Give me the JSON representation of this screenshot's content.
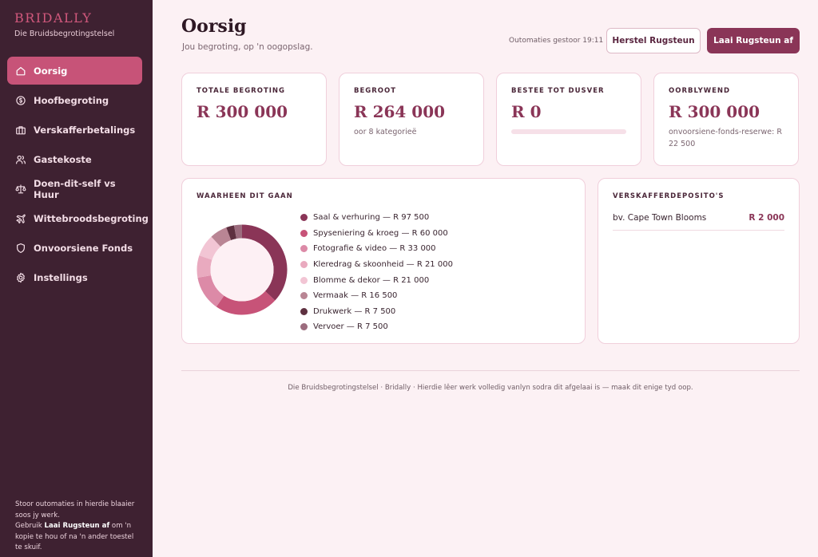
{
  "brand": {
    "name": "BRIDALLY",
    "subtitle": "Die Bruidsbegrotingstelsel"
  },
  "nav": [
    {
      "label": "Oorsig",
      "icon": "home-icon",
      "active": true
    },
    {
      "label": "Hoofbegroting",
      "icon": "coin-icon"
    },
    {
      "label": "Verskafferbetalings",
      "icon": "briefcase-icon"
    },
    {
      "label": "Gastekoste",
      "icon": "users-icon"
    },
    {
      "label": "Doen-dit-self vs Huur",
      "icon": "scale-icon"
    },
    {
      "label": "Wittebroodsbegroting",
      "icon": "plane-icon"
    },
    {
      "label": "Onvoorsiene Fonds",
      "icon": "shield-icon"
    },
    {
      "label": "Instellings",
      "icon": "gear-icon"
    }
  ],
  "sidebar_note": {
    "line1": "Stoor outomaties in hierdie blaaier soos jy werk.",
    "prefix": "Gebruik ",
    "bold": "Laai Rugsteun af",
    "suffix": " om 'n kopie te hou of na 'n ander toestel te skuif."
  },
  "header": {
    "title": "Oorsig",
    "subtitle": "Jou begroting, op 'n oogopslag.",
    "autosave": "Outomaties gestoor 19:11",
    "restore_label": "Herstel Rugsteun",
    "download_label": "Laai Rugsteun af"
  },
  "stats": {
    "total": {
      "label": "TOTALE BEGROTING",
      "value": "R 300 000"
    },
    "budgeted": {
      "label": "BEGROOT",
      "value": "R 264 000",
      "sub": "oor 8 kategorieë"
    },
    "spent": {
      "label": "BESTEE TOT DUSVER",
      "value": "R 0",
      "progress": 0
    },
    "remaining": {
      "label": "OORBLYWEND",
      "value": "R 300 000",
      "sub": "onvoorsiene-fonds-reserwe: R 22 500"
    }
  },
  "breakdown": {
    "label": "WAARHEEN DIT GAAN",
    "items": [
      {
        "label": "Saal & verhuring — R 97 500",
        "value": 97500,
        "color": "#8a3557"
      },
      {
        "label": "Spyseniering & kroeg — R 60 000",
        "value": 60000,
        "color": "#c75378"
      },
      {
        "label": "Fotografie & video — R 33 000",
        "value": 33000,
        "color": "#dc8aa7"
      },
      {
        "label": "Kleredrag & skoonheid — R 21 000",
        "value": 21000,
        "color": "#e9aabf"
      },
      {
        "label": "Blomme & dekor — R 21 000",
        "value": 21000,
        "color": "#f2c5d4"
      },
      {
        "label": "Vermaak — R 16 500",
        "value": 16500,
        "color": "#b98594"
      },
      {
        "label": "Drukwerk — R 7 500",
        "value": 7500,
        "color": "#5e3040"
      },
      {
        "label": "Vervoer — R 7 500",
        "value": 7500,
        "color": "#9c6c7e"
      }
    ]
  },
  "deposits": {
    "label": "VERSKAFFERDEPOSITO'S",
    "rows": [
      {
        "name": "bv. Cape Town Blooms",
        "amount": "R 2 000"
      }
    ]
  },
  "footer": "Die Bruidsbegrotingstelsel · Bridally · Hierdie lêer werk volledig vanlyn sodra dit afgelaai is — maak dit enige tyd oop."
}
